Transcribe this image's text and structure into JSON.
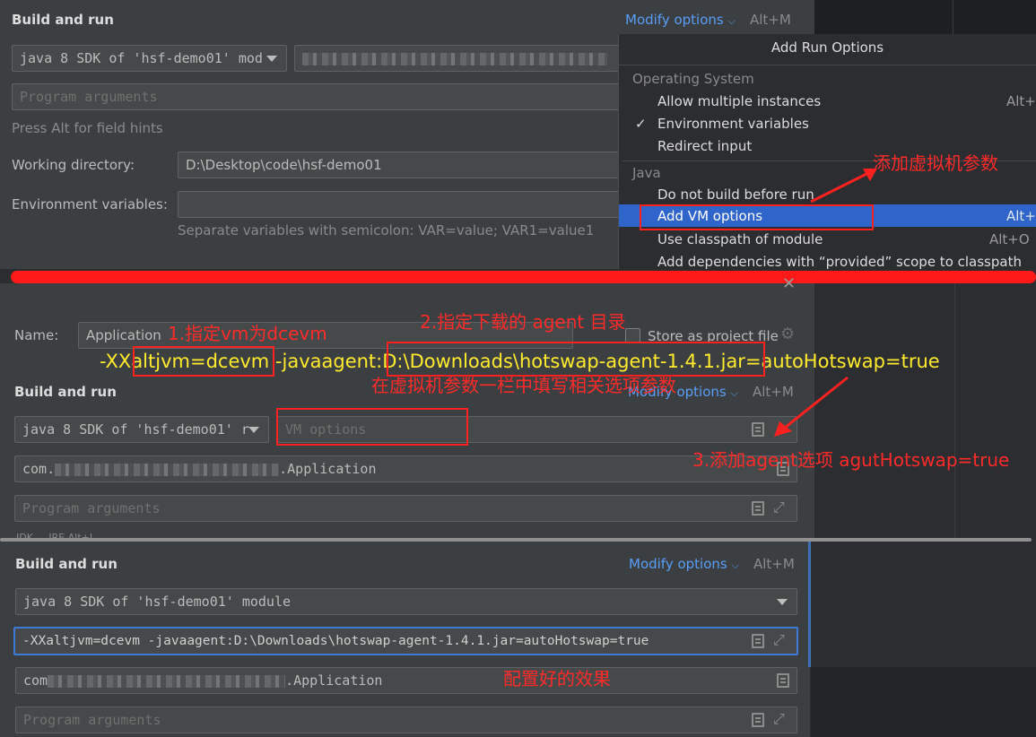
{
  "top": {
    "section_title": "Build and run",
    "modify_options": "Modify options",
    "modify_shortcut": "Alt+M",
    "jdk_select": "java 8 SDK of 'hsf-demo01' mod",
    "program_args_placeholder": "Program arguments",
    "field_hint": "Press Alt for field hints",
    "working_dir_label": "Working directory:",
    "working_dir_value": "D:\\Desktop\\code\\hsf-demo01",
    "env_label": "Environment variables:",
    "env_hint": "Separate variables with semicolon: VAR=value; VAR1=value1"
  },
  "menu": {
    "title": "Add Run Options",
    "sections": [
      {
        "title": "Operating System",
        "items": [
          {
            "label": "Allow multiple instances",
            "shortcut": "Alt+U"
          },
          {
            "label": "Environment variables",
            "checked": "✓"
          },
          {
            "label": "Redirect input"
          }
        ]
      },
      {
        "title": "Java",
        "items": [
          {
            "label": "Do not build before run"
          },
          {
            "label": "Add VM options",
            "shortcut": "Alt+V"
          },
          {
            "label": "Use classpath of module",
            "shortcut": "Alt+O"
          },
          {
            "label": "Add dependencies with “provided” scope to classpath"
          }
        ]
      }
    ]
  },
  "middle": {
    "name_label": "Name:",
    "name_value": "Application",
    "store_label": "Store as project file",
    "section_title": "Build and run",
    "modify_options": "Modify options",
    "modify_shortcut": "Alt+M",
    "jdk_select": "java 8 SDK of 'hsf-demo01' r",
    "vm_placeholder": "VM options",
    "main_class_prefix": "com.",
    "main_class_suffix": ".Application",
    "program_args_placeholder": "Program arguments",
    "cut_text": "JDK ... JRE Alt+J"
  },
  "bottom": {
    "section_title": "Build and run",
    "modify_options": "Modify options",
    "modify_shortcut": "Alt+M",
    "jdk_select": "java 8 SDK of 'hsf-demo01' module",
    "vm_value": "-XXaltjvm=dcevm -javaagent:D:\\Downloads\\hotswap-agent-1.4.1.jar=autoHotswap=true",
    "main_class_prefix": "com",
    "main_class_suffix": ".Application",
    "program_args_placeholder": "Program arguments"
  },
  "annotations": {
    "add_vm_params": "添加虚拟机参数",
    "step1": "1.指定vm为dcevm",
    "step2": "2.指定下载的 agent 目录",
    "fill_params": "在虚拟机参数一栏中填写相关选项参数",
    "step3": "3.添加agent选项 agutHotswap=true",
    "result": "配置好的效果",
    "cmd_prefix": "-XX",
    "cmd_altjvm": "altjvm=dcevm",
    "cmd_javaagent": " -javaagent:",
    "cmd_path": "D:\\Downloads\\hotswap-agent-1.4.1.jar",
    "cmd_tail": "=autoHotswap=true"
  },
  "colors": {
    "annotation_red": "#ff2a2a",
    "annotation_yellow": "#ffeb2e",
    "link_blue": "#589df6",
    "selected_blue": "#2f65ca"
  }
}
